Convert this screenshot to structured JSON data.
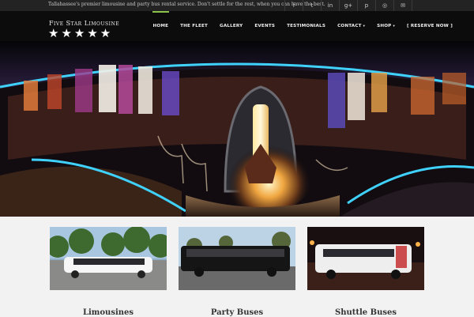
{
  "topbar": {
    "tagline": "Tallahassee's premier limousine and party bus rental service. Don't settle for the rest, when you can have the best.",
    "social_icons": [
      {
        "name": "facebook-icon",
        "glyph": "f"
      },
      {
        "name": "twitter-icon",
        "glyph": "t"
      },
      {
        "name": "linkedin-icon",
        "glyph": "in"
      },
      {
        "name": "google-plus-icon",
        "glyph": "g+"
      },
      {
        "name": "pinterest-icon",
        "glyph": "p"
      },
      {
        "name": "instagram-icon",
        "glyph": "◎"
      },
      {
        "name": "email-icon",
        "glyph": "✉"
      }
    ]
  },
  "header": {
    "brand": "Five Star Limousine",
    "stars": "★★★★★",
    "accent_color": "#8bc34a"
  },
  "nav": {
    "items": [
      {
        "label": "HOME",
        "active": true
      },
      {
        "label": "THE FLEET"
      },
      {
        "label": "GALLERY"
      },
      {
        "label": "EVENTS"
      },
      {
        "label": "TESTIMONIALS"
      },
      {
        "label": "CONTACT",
        "caret": "▾"
      },
      {
        "label": "SHOP",
        "caret": "▾"
      },
      {
        "label": "[ RESERVE NOW ]"
      }
    ]
  },
  "hero": {
    "image": "limousine-interior-bar"
  },
  "services": [
    {
      "title": "Limousines",
      "image": "white-limousine-photo"
    },
    {
      "title": "Party Buses",
      "image": "black-party-bus-photo"
    },
    {
      "title": "Shuttle Buses",
      "image": "white-shuttle-bus-photo"
    }
  ]
}
